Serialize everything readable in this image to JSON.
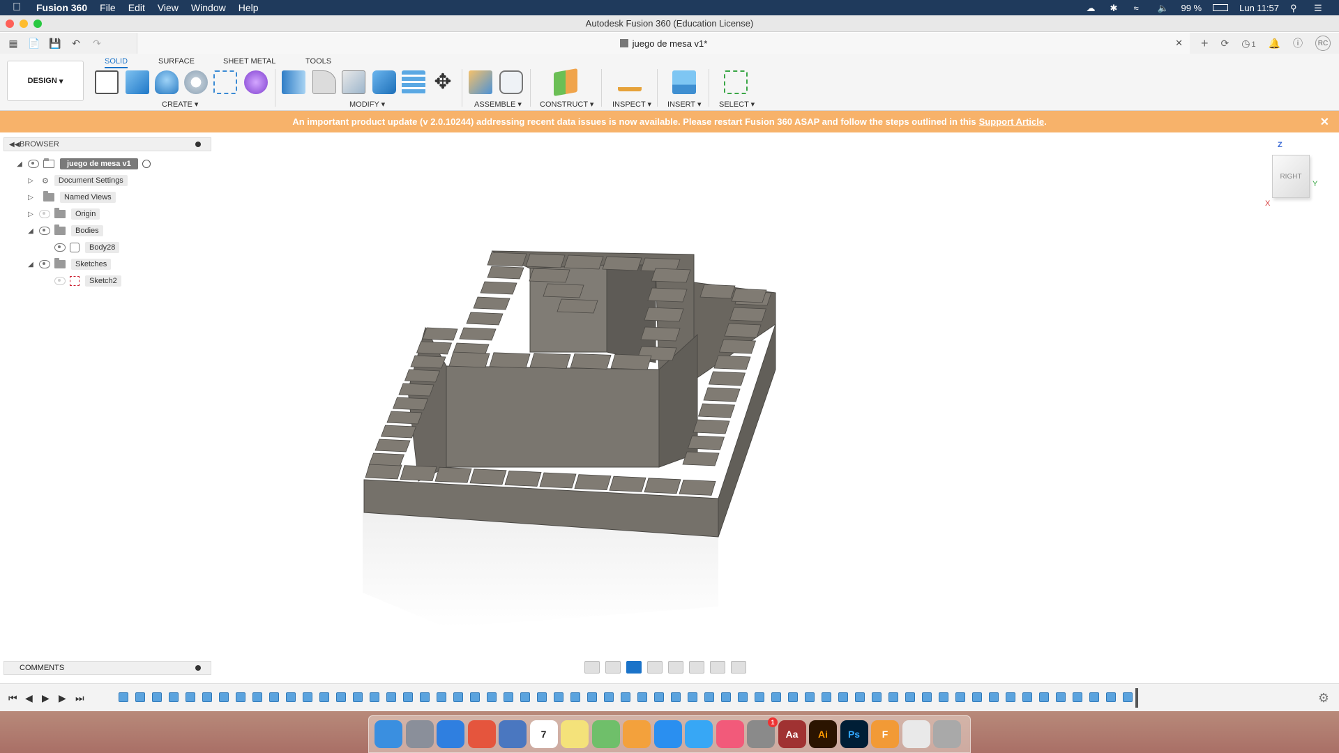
{
  "menubar": {
    "app_name": "Fusion 360",
    "items": [
      "File",
      "Edit",
      "View",
      "Window",
      "Help"
    ],
    "battery": "99 %",
    "clock": "Lun 11:57"
  },
  "window": {
    "title": "Autodesk Fusion 360 (Education License)"
  },
  "document": {
    "tab_title": "juego de mesa v1*",
    "notifications": "1",
    "user_initials": "RC"
  },
  "ribbon": {
    "workspace": "DESIGN",
    "tabs": [
      "SOLID",
      "SURFACE",
      "SHEET METAL",
      "TOOLS"
    ],
    "groups": [
      "CREATE",
      "MODIFY",
      "ASSEMBLE",
      "CONSTRUCT",
      "INSPECT",
      "INSERT",
      "SELECT"
    ]
  },
  "banner": {
    "message": "An important product update (v 2.0.10244) addressing recent data issues is now available. Please restart Fusion 360 ASAP and follow the steps outlined in this",
    "link": "Support Article",
    "suffix": "."
  },
  "browser": {
    "title": "BROWSER",
    "root": "juego de mesa v1",
    "items": [
      "Document Settings",
      "Named Views",
      "Origin",
      "Bodies",
      "Body28",
      "Sketches",
      "Sketch2"
    ]
  },
  "comments": {
    "title": "COMMENTS"
  },
  "viewcube": {
    "face": "RIGHT",
    "axis_z": "Z",
    "axis_y": "Y",
    "axis_x": "X"
  },
  "colors": {
    "accent": "#1a73c9",
    "banner": "#f7b26a",
    "menubar": "#1f3a5c",
    "model": "#75716a"
  },
  "dock": {
    "apps": [
      "Finder",
      "Launchpad",
      "Safari",
      "Chrome",
      "Xcode",
      "Calendar",
      "Notes",
      "Maps",
      "Photos",
      "App Store",
      "Messages",
      "Music",
      "System Preferences",
      "Dictionary",
      "Illustrator",
      "Photoshop",
      "Fusion 360",
      "Documents",
      "Trash"
    ],
    "calendar_day": "7",
    "sysprefs_badge": "1",
    "dictionary_label": "Aa",
    "illustrator_label": "Ai",
    "photoshop_label": "Ps",
    "fusion_label": "F"
  }
}
